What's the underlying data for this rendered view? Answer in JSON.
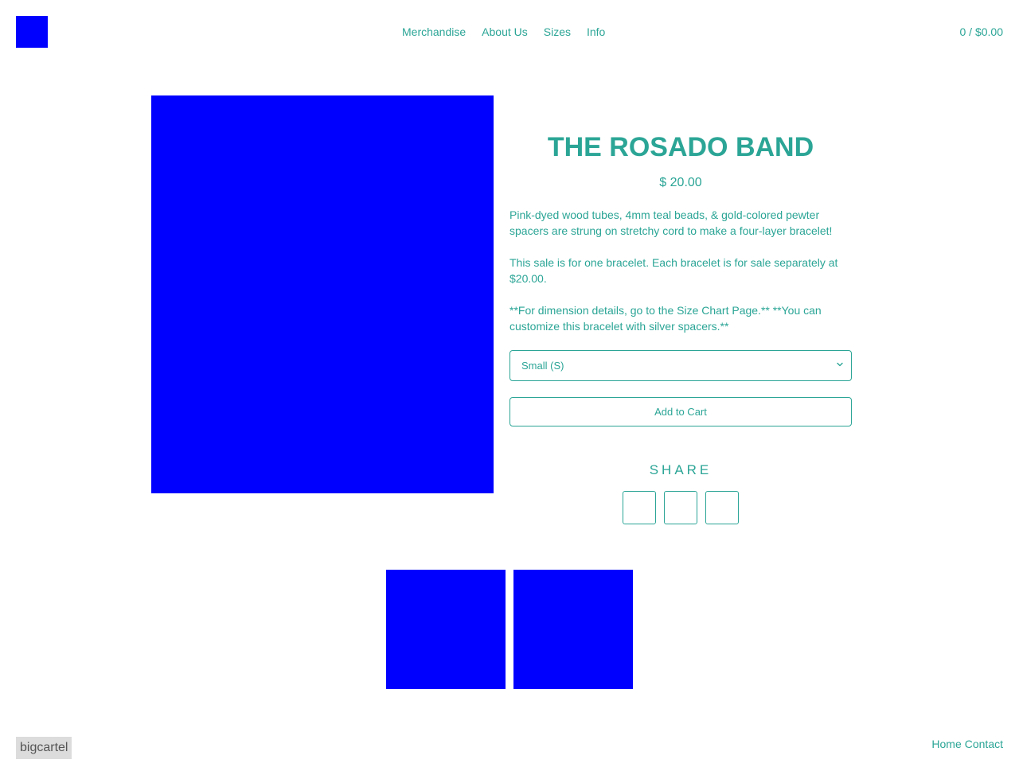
{
  "header": {
    "logo_icon": "store-logo",
    "nav": [
      {
        "label": "Merchandise"
      },
      {
        "label": "About Us"
      },
      {
        "label": "Sizes"
      },
      {
        "label": "Info"
      }
    ],
    "cart_summary": "0 / $0.00"
  },
  "product": {
    "title": "THE ROSADO BAND",
    "price": "$ 20.00",
    "description": [
      "Pink-dyed wood tubes, 4mm teal beads, & gold-colored pewter spacers are strung on stretchy cord to make a four-layer bracelet!",
      "This sale is for one bracelet. Each bracelet is for sale separately at $20.00.",
      "**For dimension details, go to the Size Chart Page.** **You can customize this bracelet with silver spacers.**"
    ],
    "option_selected": "Small (S)",
    "add_to_cart_label": "Add to Cart",
    "share_label": "SHARE"
  },
  "footer": {
    "badge": "bigcartel",
    "links": [
      {
        "label": "Home"
      },
      {
        "label": "Contact"
      }
    ]
  },
  "colors": {
    "accent": "#2ba596",
    "image_placeholder": "#0000ff",
    "badge_bg": "#dcdcdc",
    "badge_text": "#555555"
  }
}
